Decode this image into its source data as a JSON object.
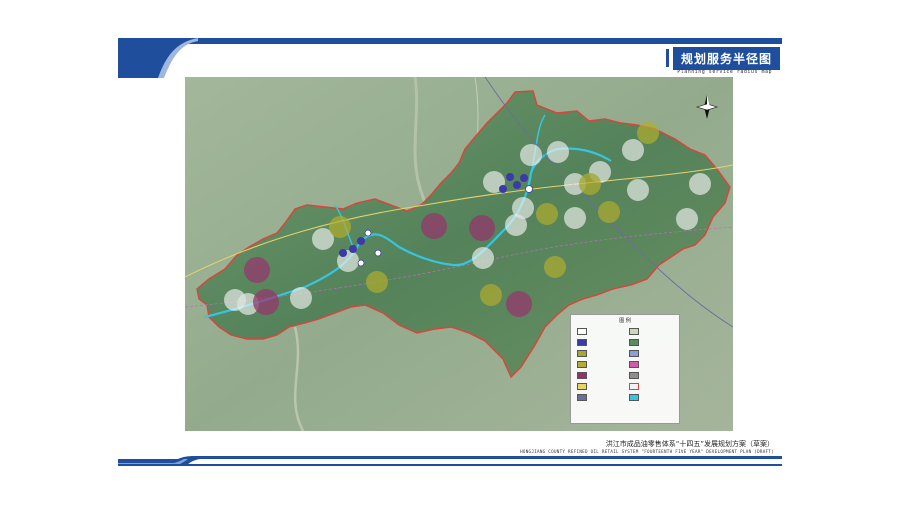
{
  "header": {
    "title": "规划服务半径图",
    "subtitle": "Planning service radius map"
  },
  "footer": {
    "title": "洪江市成品油零售体系“十四五”发展规划方案（草案）",
    "subtitle": "HONGJIANG COUNTY REFINED OIL RETAIL SYSTEM \"FOURTEENTH FIVE YEAR\" DEVELOPMENT PLAN (DRAFT)"
  },
  "legend": {
    "title": "图 例",
    "colors": {
      "existing": "#ffffff",
      "planned_blue": "#3b3aa8",
      "planned_olive": "#a6a830",
      "planned_purple": "#9a2f6e",
      "boundary": "#e0413a",
      "river": "#35c5e0"
    }
  },
  "colors": {
    "brand_blue": "#1f4e9c",
    "county_fill": "#5e8a5c",
    "basemap": "#93ab8c"
  },
  "icons": {
    "compass": "north-arrow-icon"
  }
}
